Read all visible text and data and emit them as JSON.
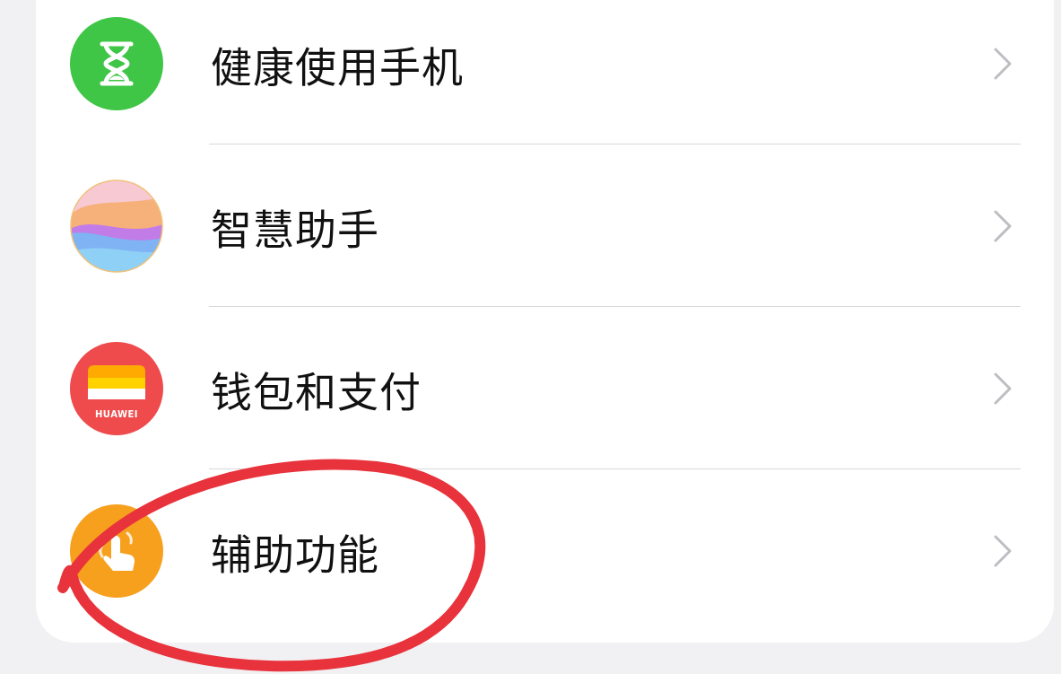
{
  "settings_items": [
    {
      "label": "健康使用手机",
      "kind": "hourglass"
    },
    {
      "label": "智慧助手",
      "kind": "orb"
    },
    {
      "label": "钱包和支付",
      "kind": "wallet",
      "icon_text": "HUAWEI"
    },
    {
      "label": "辅助功能",
      "kind": "hand"
    }
  ],
  "annotation": {
    "kind": "circle",
    "color": "#e8333c"
  }
}
